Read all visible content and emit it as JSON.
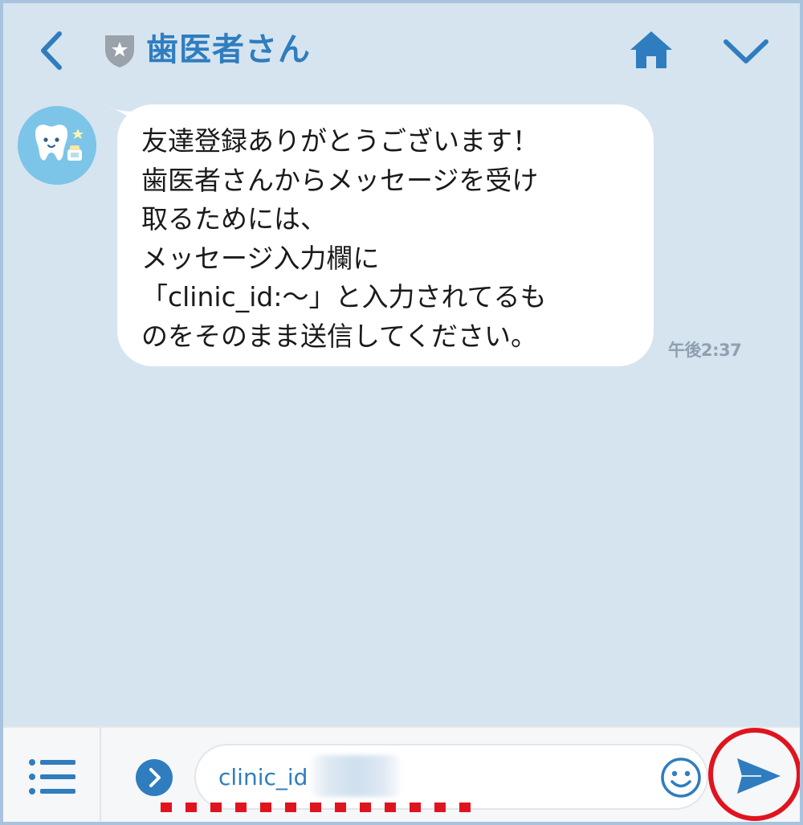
{
  "header": {
    "title": "歯医者さん",
    "back_icon": "chevron-left-icon",
    "account_icon": "shield-star-icon",
    "home_icon": "home-icon",
    "menu_icon": "chevron-down-icon"
  },
  "chat": {
    "messages": [
      {
        "sender": "歯医者さん",
        "avatar_icon": "tooth-avatar-icon",
        "text": "友達登録ありがとうございます！\n歯医者さんからメッセージを受け\n取るためには、\nメッセージ入力欄に\n「clinic_id:〜」と入力されてるも\nのをそのまま送信してください。",
        "time": "午後2:37"
      }
    ]
  },
  "input_bar": {
    "menu_icon": "list-menu-icon",
    "expand_icon": "chevron-right-circle-icon",
    "value": "clinic_id",
    "emoji_icon": "smiley-icon",
    "send_icon": "send-icon"
  },
  "colors": {
    "chat_background": "#d6e4ef",
    "accent": "#2f7dbf",
    "highlight": "#e0141e"
  }
}
